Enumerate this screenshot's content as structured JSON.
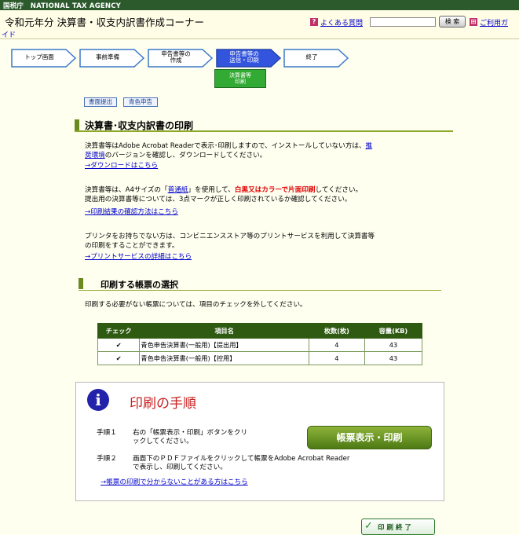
{
  "agency": "国税庁　NATIONAL TAX AGENCY",
  "header": {
    "title": "令和元年分 決算書・収支内訳書作成コーナー",
    "faq": "よくある質問",
    "search_button": "検 索",
    "guide_part1": "ご利用ガ",
    "guide_part2": "イド"
  },
  "steps": [
    {
      "label": "トップ画面"
    },
    {
      "label": "事前準備"
    },
    {
      "label": "申告書等の\n作成"
    },
    {
      "label": "申告書等の\n送信・印刷"
    },
    {
      "label": "終了"
    }
  ],
  "subtab": "決算書等\n印刷",
  "buttons": {
    "submit_doc": "書面提出",
    "blue_return": "青色申告"
  },
  "section1": {
    "title": "決算書･収支内訳書の印刷",
    "p1a": "決算書等はAdobe Acrobat Readerで表示･印刷しますので、インストールしていない方は、",
    "p1link_a": "推",
    "p1link_b": "奨環境",
    "p1b": "のバージョンを確認し、ダウンロードしてください。",
    "link1": "→ダウンロードはこちら",
    "p2a": "決算書等は、A4サイズの「",
    "p2link": "普通紙",
    "p2b": "」を使用して、",
    "p2red": "白黒又はカラーで片面印刷",
    "p2c": "してください。",
    "p2line2": "提出用の決算書等については、3点マークが正しく印刷されているか確認してください。",
    "link2": "→印刷結果の確認方法はこちら",
    "p3line1": "プリンタをお持ちでない方は、コンビニエンスストア等のプリントサービスを利用して決算書等",
    "p3line2": "の印刷をすることができます。",
    "link3": "→プリントサービスの詳細はこちら"
  },
  "section2": {
    "title": "印刷する帳票の選択",
    "desc": "印刷する必要がない帳票については、項目のチェックを外してください。",
    "headers": [
      "チェック",
      "項目名",
      "枚数(枚)",
      "容量(KB)"
    ],
    "rows": [
      {
        "check": "✔",
        "name": "青色申告決算書(一般用)【提出用】",
        "pages": "4",
        "size": "43"
      },
      {
        "check": "✔",
        "name": "青色申告決算書(一般用)【控用】",
        "pages": "4",
        "size": "43"
      }
    ]
  },
  "procedure": {
    "title": "印刷の手順",
    "step1_label": "手順１",
    "step1_text1": "右の「帳票表示・印刷」ボタンをクリ",
    "step1_text2": "ックしてください。",
    "print_button": "帳票表示・印刷",
    "step2_label": "手順２",
    "step2_text1": "画面下のＰＤＦファイルをクリックして帳票をAdobe Acrobat Reader",
    "step2_text2": "で表示し、印刷してください。",
    "help_link": "→帳票の印刷で分からないことがある方はこちら"
  },
  "done_button": "印刷終了",
  "colors": {
    "current_step": "#3355dd",
    "accent_green": "#2f5a12",
    "link": "#0000cc"
  }
}
